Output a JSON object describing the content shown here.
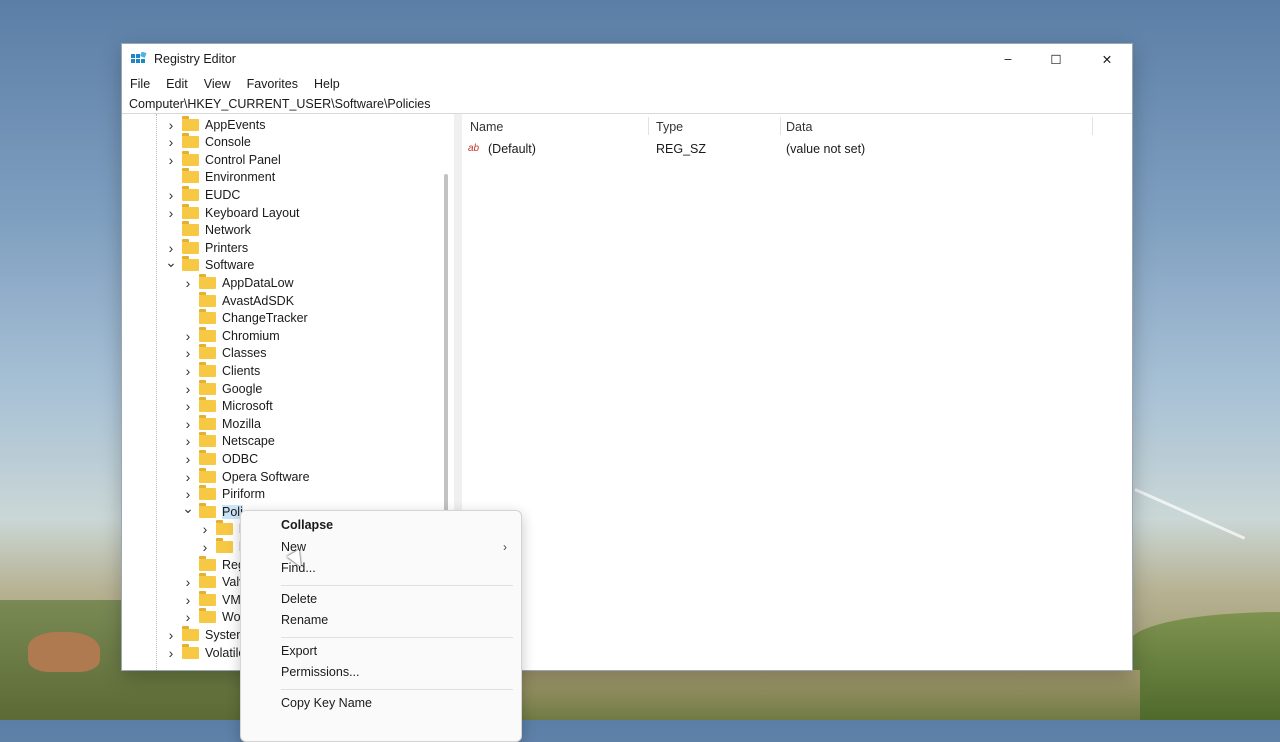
{
  "window": {
    "title": "Registry Editor",
    "controls": {
      "minimize": "–",
      "maximize": "☐",
      "close": "✕"
    },
    "menu": [
      "File",
      "Edit",
      "View",
      "Favorites",
      "Help"
    ],
    "address": "Computer\\HKEY_CURRENT_USER\\Software\\Policies"
  },
  "tree": {
    "items": [
      {
        "label": "AppEvents",
        "level": 1,
        "expander": "collapsed"
      },
      {
        "label": "Console",
        "level": 1,
        "expander": "collapsed"
      },
      {
        "label": "Control Panel",
        "level": 1,
        "expander": "collapsed"
      },
      {
        "label": "Environment",
        "level": 1,
        "expander": "none"
      },
      {
        "label": "EUDC",
        "level": 1,
        "expander": "collapsed"
      },
      {
        "label": "Keyboard Layout",
        "level": 1,
        "expander": "collapsed"
      },
      {
        "label": "Network",
        "level": 1,
        "expander": "none"
      },
      {
        "label": "Printers",
        "level": 1,
        "expander": "collapsed"
      },
      {
        "label": "Software",
        "level": 1,
        "expander": "expanded"
      },
      {
        "label": "AppDataLow",
        "level": 2,
        "expander": "collapsed"
      },
      {
        "label": "AvastAdSDK",
        "level": 2,
        "expander": "none"
      },
      {
        "label": "ChangeTracker",
        "level": 2,
        "expander": "none"
      },
      {
        "label": "Chromium",
        "level": 2,
        "expander": "collapsed"
      },
      {
        "label": "Classes",
        "level": 2,
        "expander": "collapsed"
      },
      {
        "label": "Clients",
        "level": 2,
        "expander": "collapsed"
      },
      {
        "label": "Google",
        "level": 2,
        "expander": "collapsed"
      },
      {
        "label": "Microsoft",
        "level": 2,
        "expander": "collapsed"
      },
      {
        "label": "Mozilla",
        "level": 2,
        "expander": "collapsed"
      },
      {
        "label": "Netscape",
        "level": 2,
        "expander": "collapsed"
      },
      {
        "label": "ODBC",
        "level": 2,
        "expander": "collapsed"
      },
      {
        "label": "Opera Software",
        "level": 2,
        "expander": "collapsed"
      },
      {
        "label": "Piriform",
        "level": 2,
        "expander": "collapsed"
      },
      {
        "label": "Poli",
        "level": 2,
        "expander": "expanded",
        "selected": true
      },
      {
        "label": "l",
        "level": 3,
        "expander": "collapsed"
      },
      {
        "label": "l",
        "level": 3,
        "expander": "collapsed"
      },
      {
        "label": "Reg",
        "level": 2,
        "expander": "none"
      },
      {
        "label": "Valv",
        "level": 2,
        "expander": "collapsed"
      },
      {
        "label": "VM",
        "level": 2,
        "expander": "collapsed"
      },
      {
        "label": "Wo",
        "level": 2,
        "expander": "collapsed"
      },
      {
        "label": "System",
        "level": 1,
        "expander": "collapsed"
      },
      {
        "label": "Volatile",
        "level": 1,
        "expander": "collapsed"
      }
    ]
  },
  "values_pane": {
    "columns": [
      "Name",
      "Type",
      "Data"
    ],
    "rows": [
      {
        "icon": "ab",
        "name": "(Default)",
        "type": "REG_SZ",
        "data": "(value not set)"
      }
    ]
  },
  "context_menu": {
    "items": [
      {
        "label": "Collapse",
        "bold": true
      },
      {
        "label": "New",
        "submenu": true
      },
      {
        "label": "Find..."
      },
      {
        "sep": true
      },
      {
        "label": "Delete"
      },
      {
        "label": "Rename"
      },
      {
        "sep": true
      },
      {
        "label": "Export"
      },
      {
        "label": "Permissions..."
      },
      {
        "sep": true
      },
      {
        "label": "Copy Key Name"
      }
    ],
    "submenu_arrow": "›"
  }
}
